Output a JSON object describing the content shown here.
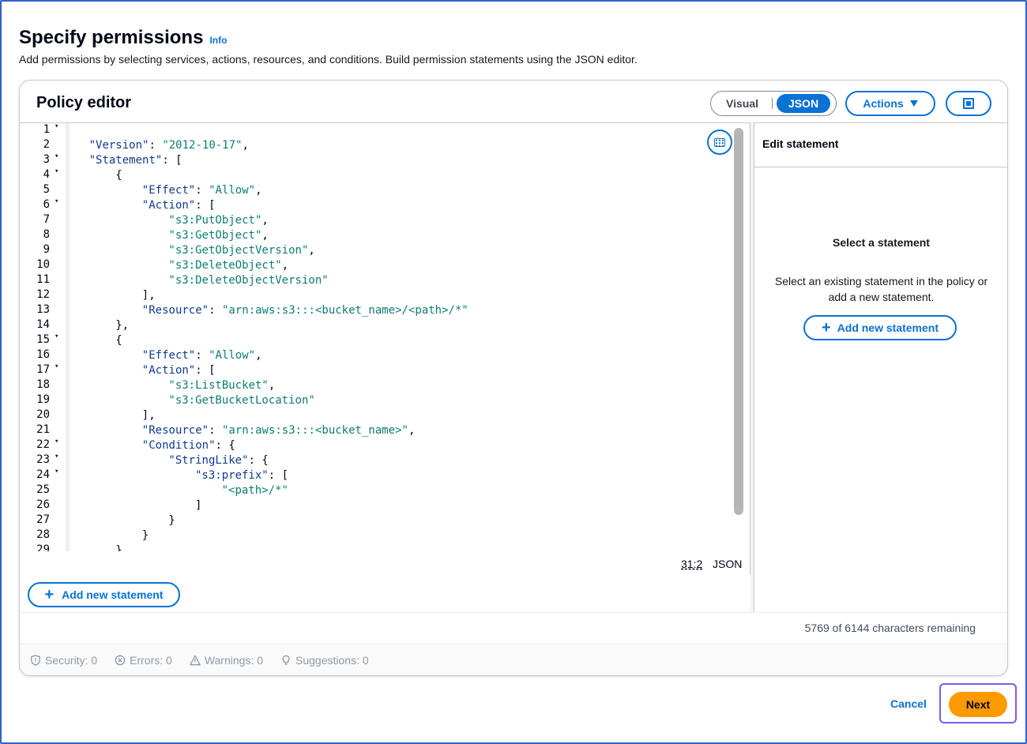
{
  "header": {
    "title": "Specify permissions",
    "info_label": "Info",
    "description": "Add permissions by selecting services, actions, resources, and conditions. Build permission statements using the JSON editor."
  },
  "policy_editor": {
    "title": "Policy editor",
    "mode_visual": "Visual",
    "mode_json": "JSON",
    "actions_label": "Actions",
    "cursor_position": "31:2",
    "language": "JSON",
    "add_statement_label": "Add new statement",
    "characters_remaining": "5769 of 6144 characters remaining",
    "code_lines": [
      {
        "n": "1",
        "fold": true,
        "indent": 0,
        "parts": []
      },
      {
        "n": "2",
        "fold": false,
        "indent": 1,
        "parts": [
          {
            "t": "key",
            "v": "\"Version\""
          },
          {
            "t": "p",
            "v": ": "
          },
          {
            "t": "str",
            "v": "\"2012-10-17\""
          },
          {
            "t": "p",
            "v": ","
          }
        ]
      },
      {
        "n": "3",
        "fold": true,
        "indent": 1,
        "parts": [
          {
            "t": "key",
            "v": "\"Statement\""
          },
          {
            "t": "p",
            "v": ": ["
          }
        ]
      },
      {
        "n": "4",
        "fold": true,
        "indent": 2,
        "parts": [
          {
            "t": "p",
            "v": "{"
          }
        ]
      },
      {
        "n": "5",
        "fold": false,
        "indent": 3,
        "parts": [
          {
            "t": "key",
            "v": "\"Effect\""
          },
          {
            "t": "p",
            "v": ": "
          },
          {
            "t": "str",
            "v": "\"Allow\""
          },
          {
            "t": "p",
            "v": ","
          }
        ]
      },
      {
        "n": "6",
        "fold": true,
        "indent": 3,
        "parts": [
          {
            "t": "key",
            "v": "\"Action\""
          },
          {
            "t": "p",
            "v": ": ["
          }
        ]
      },
      {
        "n": "7",
        "fold": false,
        "indent": 4,
        "parts": [
          {
            "t": "str",
            "v": "\"s3:PutObject\""
          },
          {
            "t": "p",
            "v": ","
          }
        ]
      },
      {
        "n": "8",
        "fold": false,
        "indent": 4,
        "parts": [
          {
            "t": "str",
            "v": "\"s3:GetObject\""
          },
          {
            "t": "p",
            "v": ","
          }
        ]
      },
      {
        "n": "9",
        "fold": false,
        "indent": 4,
        "parts": [
          {
            "t": "str",
            "v": "\"s3:GetObjectVersion\""
          },
          {
            "t": "p",
            "v": ","
          }
        ]
      },
      {
        "n": "10",
        "fold": false,
        "indent": 4,
        "parts": [
          {
            "t": "str",
            "v": "\"s3:DeleteObject\""
          },
          {
            "t": "p",
            "v": ","
          }
        ]
      },
      {
        "n": "11",
        "fold": false,
        "indent": 4,
        "parts": [
          {
            "t": "str",
            "v": "\"s3:DeleteObjectVersion\""
          }
        ]
      },
      {
        "n": "12",
        "fold": false,
        "indent": 3,
        "parts": [
          {
            "t": "p",
            "v": "],"
          }
        ]
      },
      {
        "n": "13",
        "fold": false,
        "indent": 3,
        "parts": [
          {
            "t": "key",
            "v": "\"Resource\""
          },
          {
            "t": "p",
            "v": ": "
          },
          {
            "t": "str",
            "v": "\"arn:aws:s3:::<bucket_name>/<path>/*\""
          }
        ]
      },
      {
        "n": "14",
        "fold": false,
        "indent": 2,
        "parts": [
          {
            "t": "p",
            "v": "},"
          }
        ]
      },
      {
        "n": "15",
        "fold": true,
        "indent": 2,
        "parts": [
          {
            "t": "p",
            "v": "{"
          }
        ]
      },
      {
        "n": "16",
        "fold": false,
        "indent": 3,
        "parts": [
          {
            "t": "key",
            "v": "\"Effect\""
          },
          {
            "t": "p",
            "v": ": "
          },
          {
            "t": "str",
            "v": "\"Allow\""
          },
          {
            "t": "p",
            "v": ","
          }
        ]
      },
      {
        "n": "17",
        "fold": true,
        "indent": 3,
        "parts": [
          {
            "t": "key",
            "v": "\"Action\""
          },
          {
            "t": "p",
            "v": ": ["
          }
        ]
      },
      {
        "n": "18",
        "fold": false,
        "indent": 4,
        "parts": [
          {
            "t": "str",
            "v": "\"s3:ListBucket\""
          },
          {
            "t": "p",
            "v": ","
          }
        ]
      },
      {
        "n": "19",
        "fold": false,
        "indent": 4,
        "parts": [
          {
            "t": "str",
            "v": "\"s3:GetBucketLocation\""
          }
        ]
      },
      {
        "n": "20",
        "fold": false,
        "indent": 3,
        "parts": [
          {
            "t": "p",
            "v": "],"
          }
        ]
      },
      {
        "n": "21",
        "fold": false,
        "indent": 3,
        "parts": [
          {
            "t": "key",
            "v": "\"Resource\""
          },
          {
            "t": "p",
            "v": ": "
          },
          {
            "t": "str",
            "v": "\"arn:aws:s3:::<bucket_name>\""
          },
          {
            "t": "p",
            "v": ","
          }
        ]
      },
      {
        "n": "22",
        "fold": true,
        "indent": 3,
        "parts": [
          {
            "t": "key",
            "v": "\"Condition\""
          },
          {
            "t": "p",
            "v": ": {"
          }
        ]
      },
      {
        "n": "23",
        "fold": true,
        "indent": 4,
        "parts": [
          {
            "t": "key",
            "v": "\"StringLike\""
          },
          {
            "t": "p",
            "v": ": {"
          }
        ]
      },
      {
        "n": "24",
        "fold": true,
        "indent": 5,
        "parts": [
          {
            "t": "key",
            "v": "\"s3:prefix\""
          },
          {
            "t": "p",
            "v": ": ["
          }
        ]
      },
      {
        "n": "25",
        "fold": false,
        "indent": 6,
        "parts": [
          {
            "t": "str",
            "v": "\"<path>/*\""
          }
        ]
      },
      {
        "n": "26",
        "fold": false,
        "indent": 5,
        "parts": [
          {
            "t": "p",
            "v": "]"
          }
        ]
      },
      {
        "n": "27",
        "fold": false,
        "indent": 4,
        "parts": [
          {
            "t": "p",
            "v": "}"
          }
        ]
      },
      {
        "n": "28",
        "fold": false,
        "indent": 3,
        "parts": [
          {
            "t": "p",
            "v": "}"
          }
        ]
      },
      {
        "n": "29",
        "fold": false,
        "indent": 2,
        "parts": [
          {
            "t": "p",
            "v": "}"
          }
        ]
      }
    ]
  },
  "statement_panel": {
    "title": "Edit statement",
    "empty_title": "Select a statement",
    "empty_description": "Select an existing statement in the policy or add a new statement.",
    "add_statement_label": "Add new statement"
  },
  "validation": {
    "security": "Security: 0",
    "errors": "Errors: 0",
    "warnings": "Warnings: 0",
    "suggestions": "Suggestions: 0"
  },
  "footer": {
    "cancel_label": "Cancel",
    "next_label": "Next"
  },
  "colors": {
    "accent": "#0972d3",
    "primary_button": "#ff9900",
    "focus_ring": "#7f5af0"
  }
}
